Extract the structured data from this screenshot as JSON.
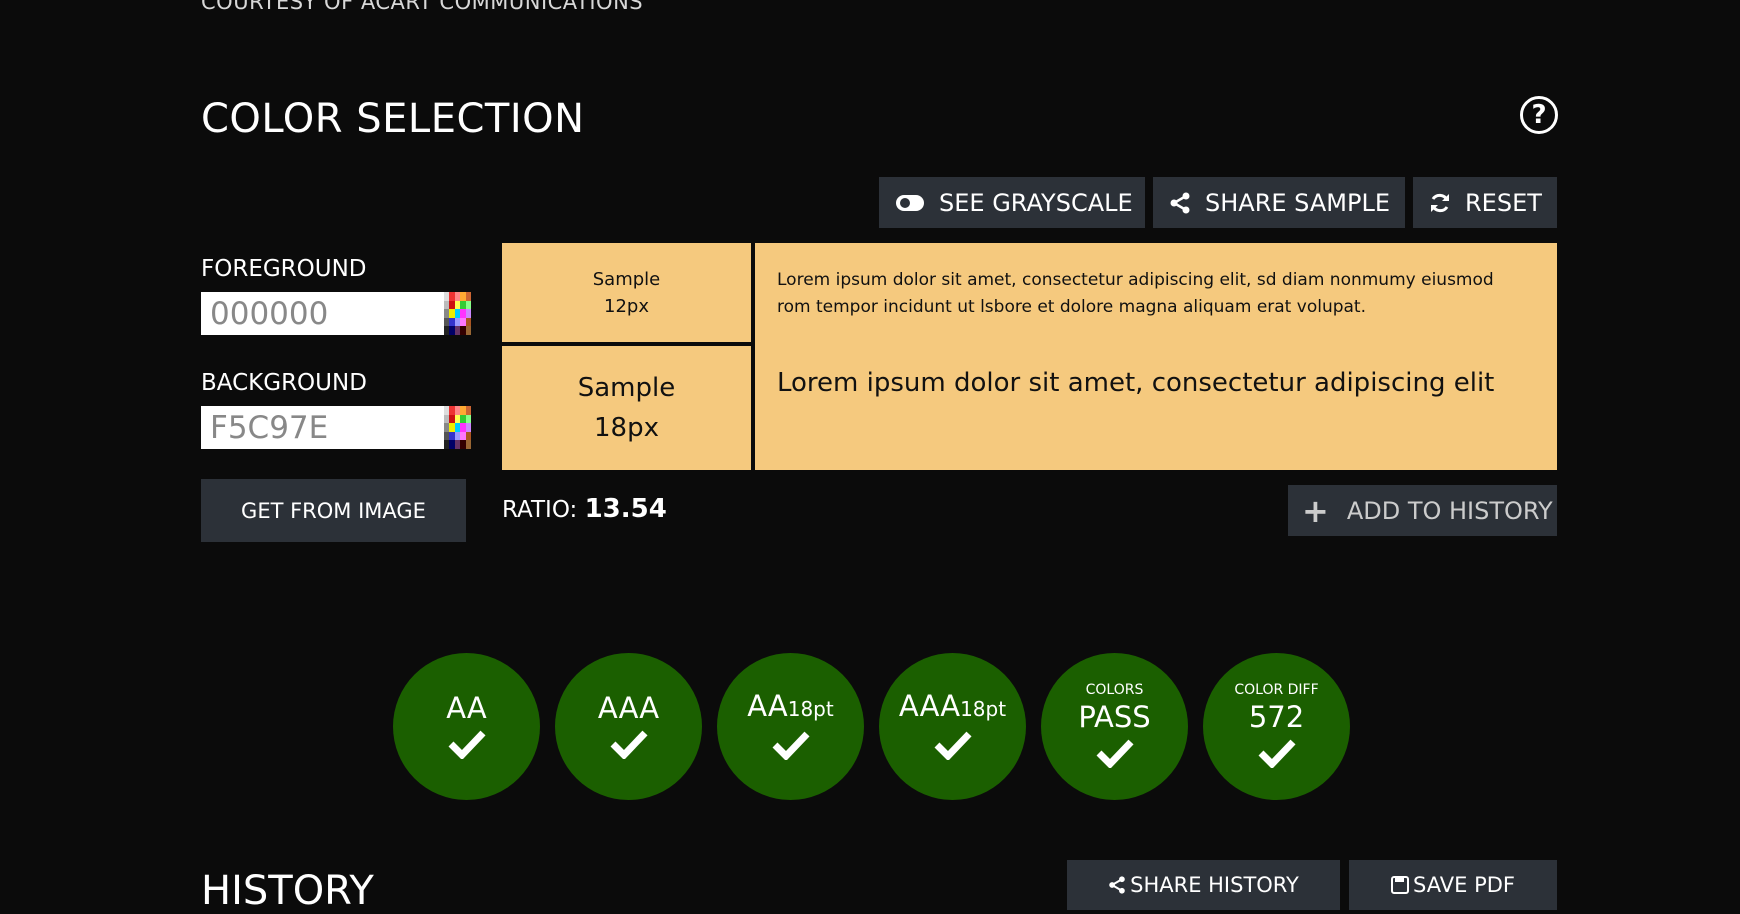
{
  "courtesy": "COURTESY OF ACART COMMUNICATIONS",
  "section_title": "COLOR SELECTION",
  "toolbar": {
    "grayscale": "SEE GRAYSCALE",
    "share_sample": "SHARE SAMPLE",
    "reset": "RESET"
  },
  "foreground": {
    "label": "FOREGROUND",
    "value": "000000"
  },
  "background": {
    "label": "BACKGROUND",
    "value": "F5C97E"
  },
  "get_from_image": "GET FROM IMAGE",
  "samples": {
    "small_line1": "Sample",
    "small_line2": "12px",
    "large_line1": "Sample",
    "large_line2": "18px",
    "lorem_small": "Lorem ipsum dolor sit amet, consectetur adipiscing elit, sd diam nonmumy eiusmod rom tempor incidunt ut lsbore et dolore magna aliquam erat volupat.",
    "lorem_large": "Lorem ipsum dolor sit amet, consectetur adipiscing elit"
  },
  "ratio": {
    "label": "RATIO:",
    "value": "13.54"
  },
  "add_to_history": "ADD TO HISTORY",
  "results": [
    {
      "top": "",
      "main": "AA",
      "sub": ""
    },
    {
      "top": "",
      "main": "AAA",
      "sub": ""
    },
    {
      "top": "",
      "main": "AA",
      "sub": "18pt"
    },
    {
      "top": "",
      "main": "AAA",
      "sub": "18pt"
    },
    {
      "top": "COLORS",
      "main": "PASS",
      "sub": ""
    },
    {
      "top": "COLOR DIFF",
      "main": "572",
      "sub": ""
    }
  ],
  "history": {
    "title": "HISTORY",
    "share": "SHARE HISTORY",
    "save": "SAVE PDF"
  },
  "colors": {
    "page_bg": "#0b0b0b",
    "button_bg": "#2c3138",
    "sample_bg": "#f5c97e",
    "pass_green": "#1b5f00"
  }
}
